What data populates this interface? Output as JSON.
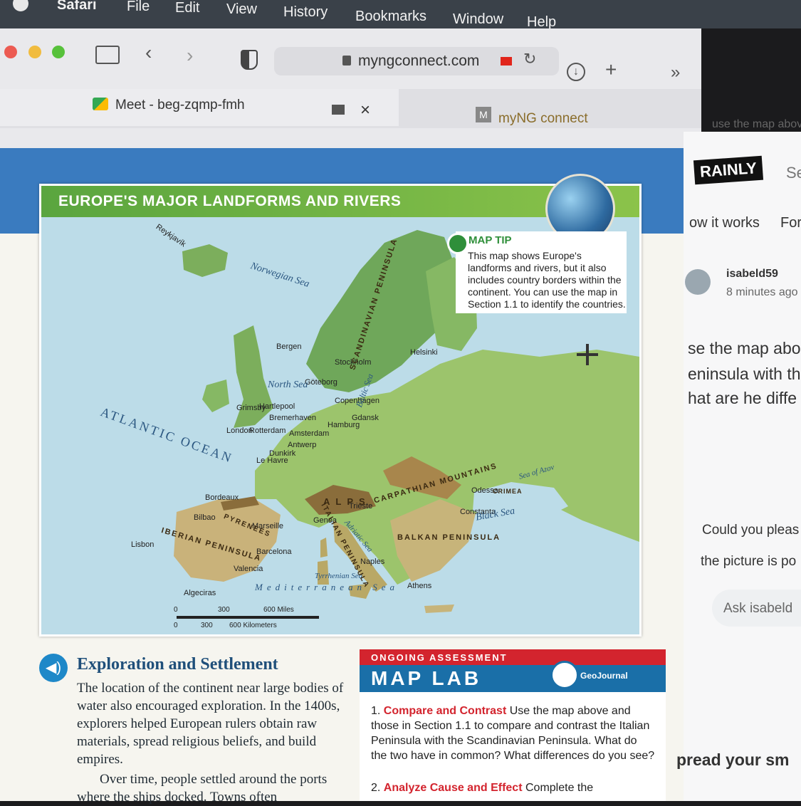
{
  "menubar": {
    "items": [
      "Safari",
      "File",
      "Edit",
      "View",
      "History",
      "Bookmarks",
      "Window",
      "Help"
    ]
  },
  "toolbar": {
    "url": "myngconnect.com"
  },
  "tabs": {
    "meet_label": "Meet - beg-zqmp-fmh",
    "close_symbol": "×",
    "myng_label": "myNG connect",
    "myng_badge": "M"
  },
  "map": {
    "title": "EUROPE'S MAJOR LANDFORMS AND RIVERS",
    "tip_heading": "MAP TIP",
    "tip_body": "This map shows Europe's landforms and rivers, but it also includes country borders within the continent. You can use the map in Section 1.1 to identify the countries.",
    "cities": [
      "Reykjavík",
      "Bergen",
      "Helsinki",
      "Stockholm",
      "Göteborg",
      "Copenhagen",
      "Hartlepool",
      "Grimsby",
      "Bremerhaven",
      "Hamburg",
      "Gdansk",
      "London",
      "Rotterdam",
      "Amsterdam",
      "Antwerp",
      "Dunkirk",
      "Le Havre",
      "Bordeaux",
      "Bilbao",
      "Marseille",
      "Genoa",
      "Trieste",
      "Barcelona",
      "Lisbon",
      "Valencia",
      "Algeciras",
      "Naples",
      "Athens",
      "Odessa",
      "Constanța"
    ],
    "seas": [
      "Norwegian Sea",
      "North Sea",
      "ATLANTIC OCEAN",
      "Baltic Sea",
      "Black Sea",
      "Sea of Azov",
      "Adriatic Sea",
      "Tyrrhenian Sea",
      "Mediterranean Sea"
    ],
    "landforms": [
      "SCANDINAVIAN PENINSULA",
      "CARPATHIAN MOUNTAINS",
      "ALPS",
      "PYRENEES",
      "IBERIAN PENINSULA",
      "BALKAN PENINSULA",
      "ITALIAN PENINSULA",
      "CRIMEA"
    ],
    "scale_miles": [
      "0",
      "300",
      "600 Miles"
    ],
    "scale_km": [
      "0",
      "300",
      "600 Kilometers"
    ]
  },
  "article": {
    "heading": "Exploration and Settlement",
    "p1": "The location of the continent near large bodies of water also encouraged exploration. In the 1400s, explorers helped European rulers obtain raw materials, spread religious beliefs, and build empires.",
    "p2": "Over time, people settled around the ports where the ships docked. Towns often"
  },
  "maplab": {
    "ongoing": "ONGOING ASSESSMENT",
    "title": "MAP LAB",
    "geojournal": "GeoJournal",
    "q1_num": "1.",
    "q1_head": "Compare and Contrast",
    "q1_text": "Use the map above and those in Section 1.1 to compare and contrast the Italian Peninsula with the Scandinavian Peninsula. What do the two have in common? What differences do you see?",
    "q2_num": "2.",
    "q2_head": "Analyze Cause and Effect",
    "q2_text": "Complete the"
  },
  "side": {
    "tab_text": "use the map abov",
    "brand": "RAINLY",
    "nav1": "ow it works",
    "nav2": "For",
    "se": "Se",
    "user": "isabeld59",
    "time": "8 minutes ago",
    "q_line1": "se the map abo",
    "q_line2": "eninsula with th",
    "q_line3": "hat are he diffe",
    "comment1": "Could you pleas",
    "comment2": "the picture is po",
    "ask": "Ask isabeld",
    "footer": "pread your sm"
  }
}
